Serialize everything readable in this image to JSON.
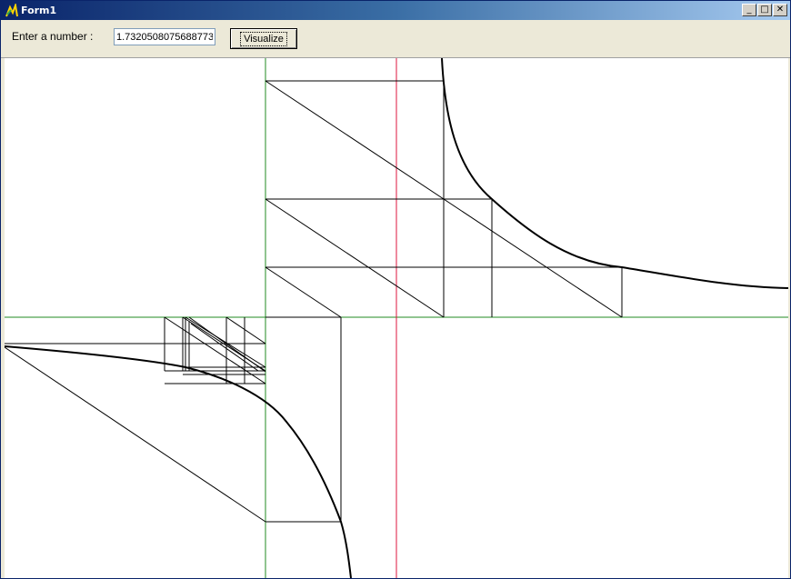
{
  "window": {
    "title": "Form1"
  },
  "titlebar_buttons": {
    "minimize": "_",
    "maximize": "□",
    "close": "✕"
  },
  "form": {
    "prompt_label": "Enter a number :",
    "number_value": "1.7320508075688773",
    "visualize_label": "Visualize"
  },
  "colors": {
    "axis": "#228b22",
    "marker": "#dc143c",
    "curve": "#000000",
    "lines": "#000000"
  },
  "icons": {
    "app": "app-icon"
  }
}
